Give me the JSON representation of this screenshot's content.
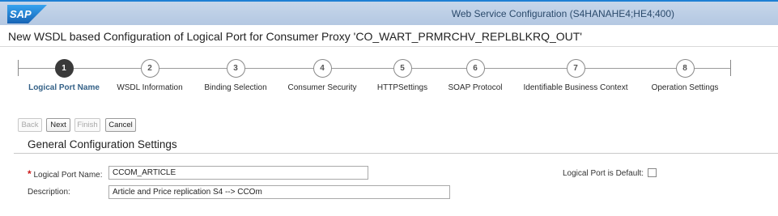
{
  "shell": {
    "logo_text": "SAP",
    "title": "Web Service Configuration (S4HANAHE4;HE4;400)",
    "colors": {
      "logo_blue": "#1a6fc0",
      "bar": "#c6d6ea"
    }
  },
  "page": {
    "title": "New WSDL based Configuration of Logical Port for Consumer Proxy 'CO_WART_PRMRCHV_REPLBLKRQ_OUT'"
  },
  "wizard": {
    "active_step": 1,
    "steps": [
      {
        "number": "1",
        "label": "Logical Port Name"
      },
      {
        "number": "2",
        "label": "WSDL Information"
      },
      {
        "number": "3",
        "label": "Binding Selection"
      },
      {
        "number": "4",
        "label": "Consumer Security"
      },
      {
        "number": "5",
        "label": "HTTPSettings"
      },
      {
        "number": "6",
        "label": "SOAP Protocol"
      },
      {
        "number": "7",
        "label": "Identifiable Business Context"
      },
      {
        "number": "8",
        "label": "Operation Settings"
      }
    ]
  },
  "toolbar": {
    "back_label": "Back",
    "next_label": "Next",
    "finish_label": "Finish",
    "cancel_label": "Cancel"
  },
  "section": {
    "title": "General Configuration Settings"
  },
  "form": {
    "required_marker": "*",
    "logical_port_name_label": "Logical Port Name:",
    "logical_port_name_value": "CCOM_ARTICLE",
    "description_label": "Description:",
    "description_value": "Article and Price replication S4 --> CCOm",
    "default_label": "Logical Port is Default:",
    "default_checked": false
  }
}
